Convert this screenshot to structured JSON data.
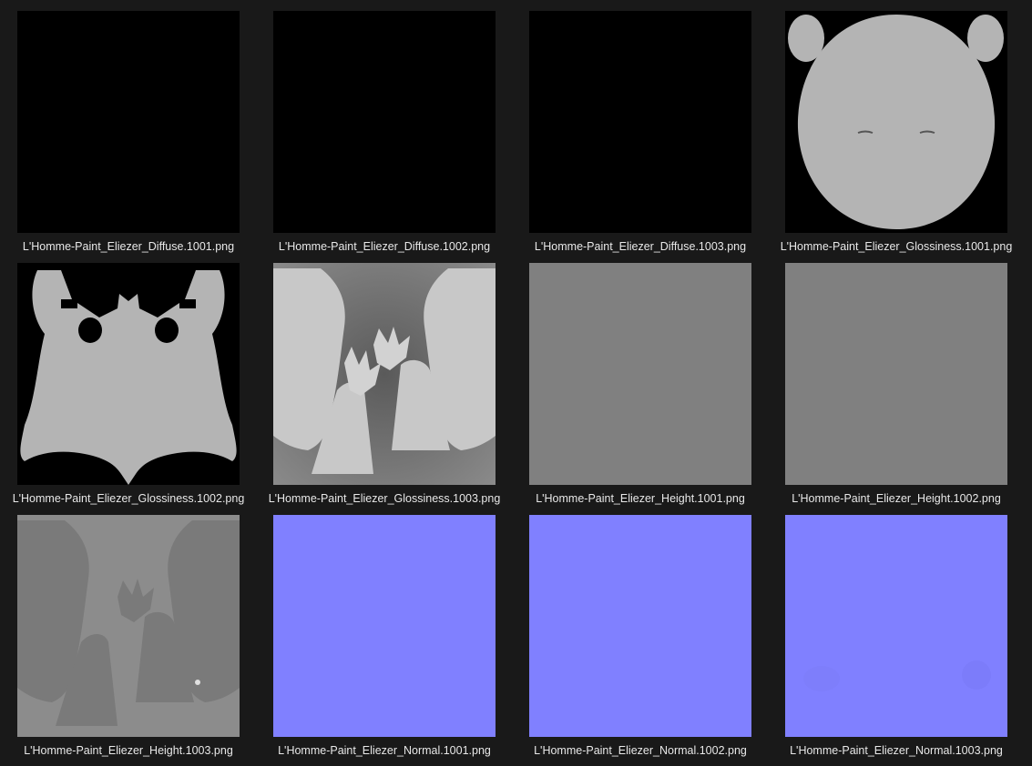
{
  "files": [
    {
      "name": "L'Homme-Paint_Eliezer_Diffuse.1001.png",
      "preview": "black-icon"
    },
    {
      "name": "L'Homme-Paint_Eliezer_Diffuse.1002.png",
      "preview": "black-icon"
    },
    {
      "name": "L'Homme-Paint_Eliezer_Diffuse.1003.png",
      "preview": "black-icon"
    },
    {
      "name": "L'Homme-Paint_Eliezer_Glossiness.1001.png",
      "preview": "head-uv-icon"
    },
    {
      "name": "L'Homme-Paint_Eliezer_Glossiness.1002.png",
      "preview": "body-uv-icon"
    },
    {
      "name": "L'Homme-Paint_Eliezer_Glossiness.1003.png",
      "preview": "limbs-uv-icon"
    },
    {
      "name": "L'Homme-Paint_Eliezer_Height.1001.png",
      "preview": "flat-gray-icon"
    },
    {
      "name": "L'Homme-Paint_Eliezer_Height.1002.png",
      "preview": "flat-gray-icon"
    },
    {
      "name": "L'Homme-Paint_Eliezer_Height.1003.png",
      "preview": "limbs-height-icon"
    },
    {
      "name": "L'Homme-Paint_Eliezer_Normal.1001.png",
      "preview": "normal-map-icon"
    },
    {
      "name": "L'Homme-Paint_Eliezer_Normal.1002.png",
      "preview": "normal-map-icon"
    },
    {
      "name": "L'Homme-Paint_Eliezer_Normal.1003.png",
      "preview": "normal-map-icon"
    }
  ],
  "colors": {
    "background": "#191919",
    "black": "#000000",
    "uv_gray": "#b4b4b4",
    "height_gray": "#808080",
    "normal_blue": "#8080ff"
  }
}
